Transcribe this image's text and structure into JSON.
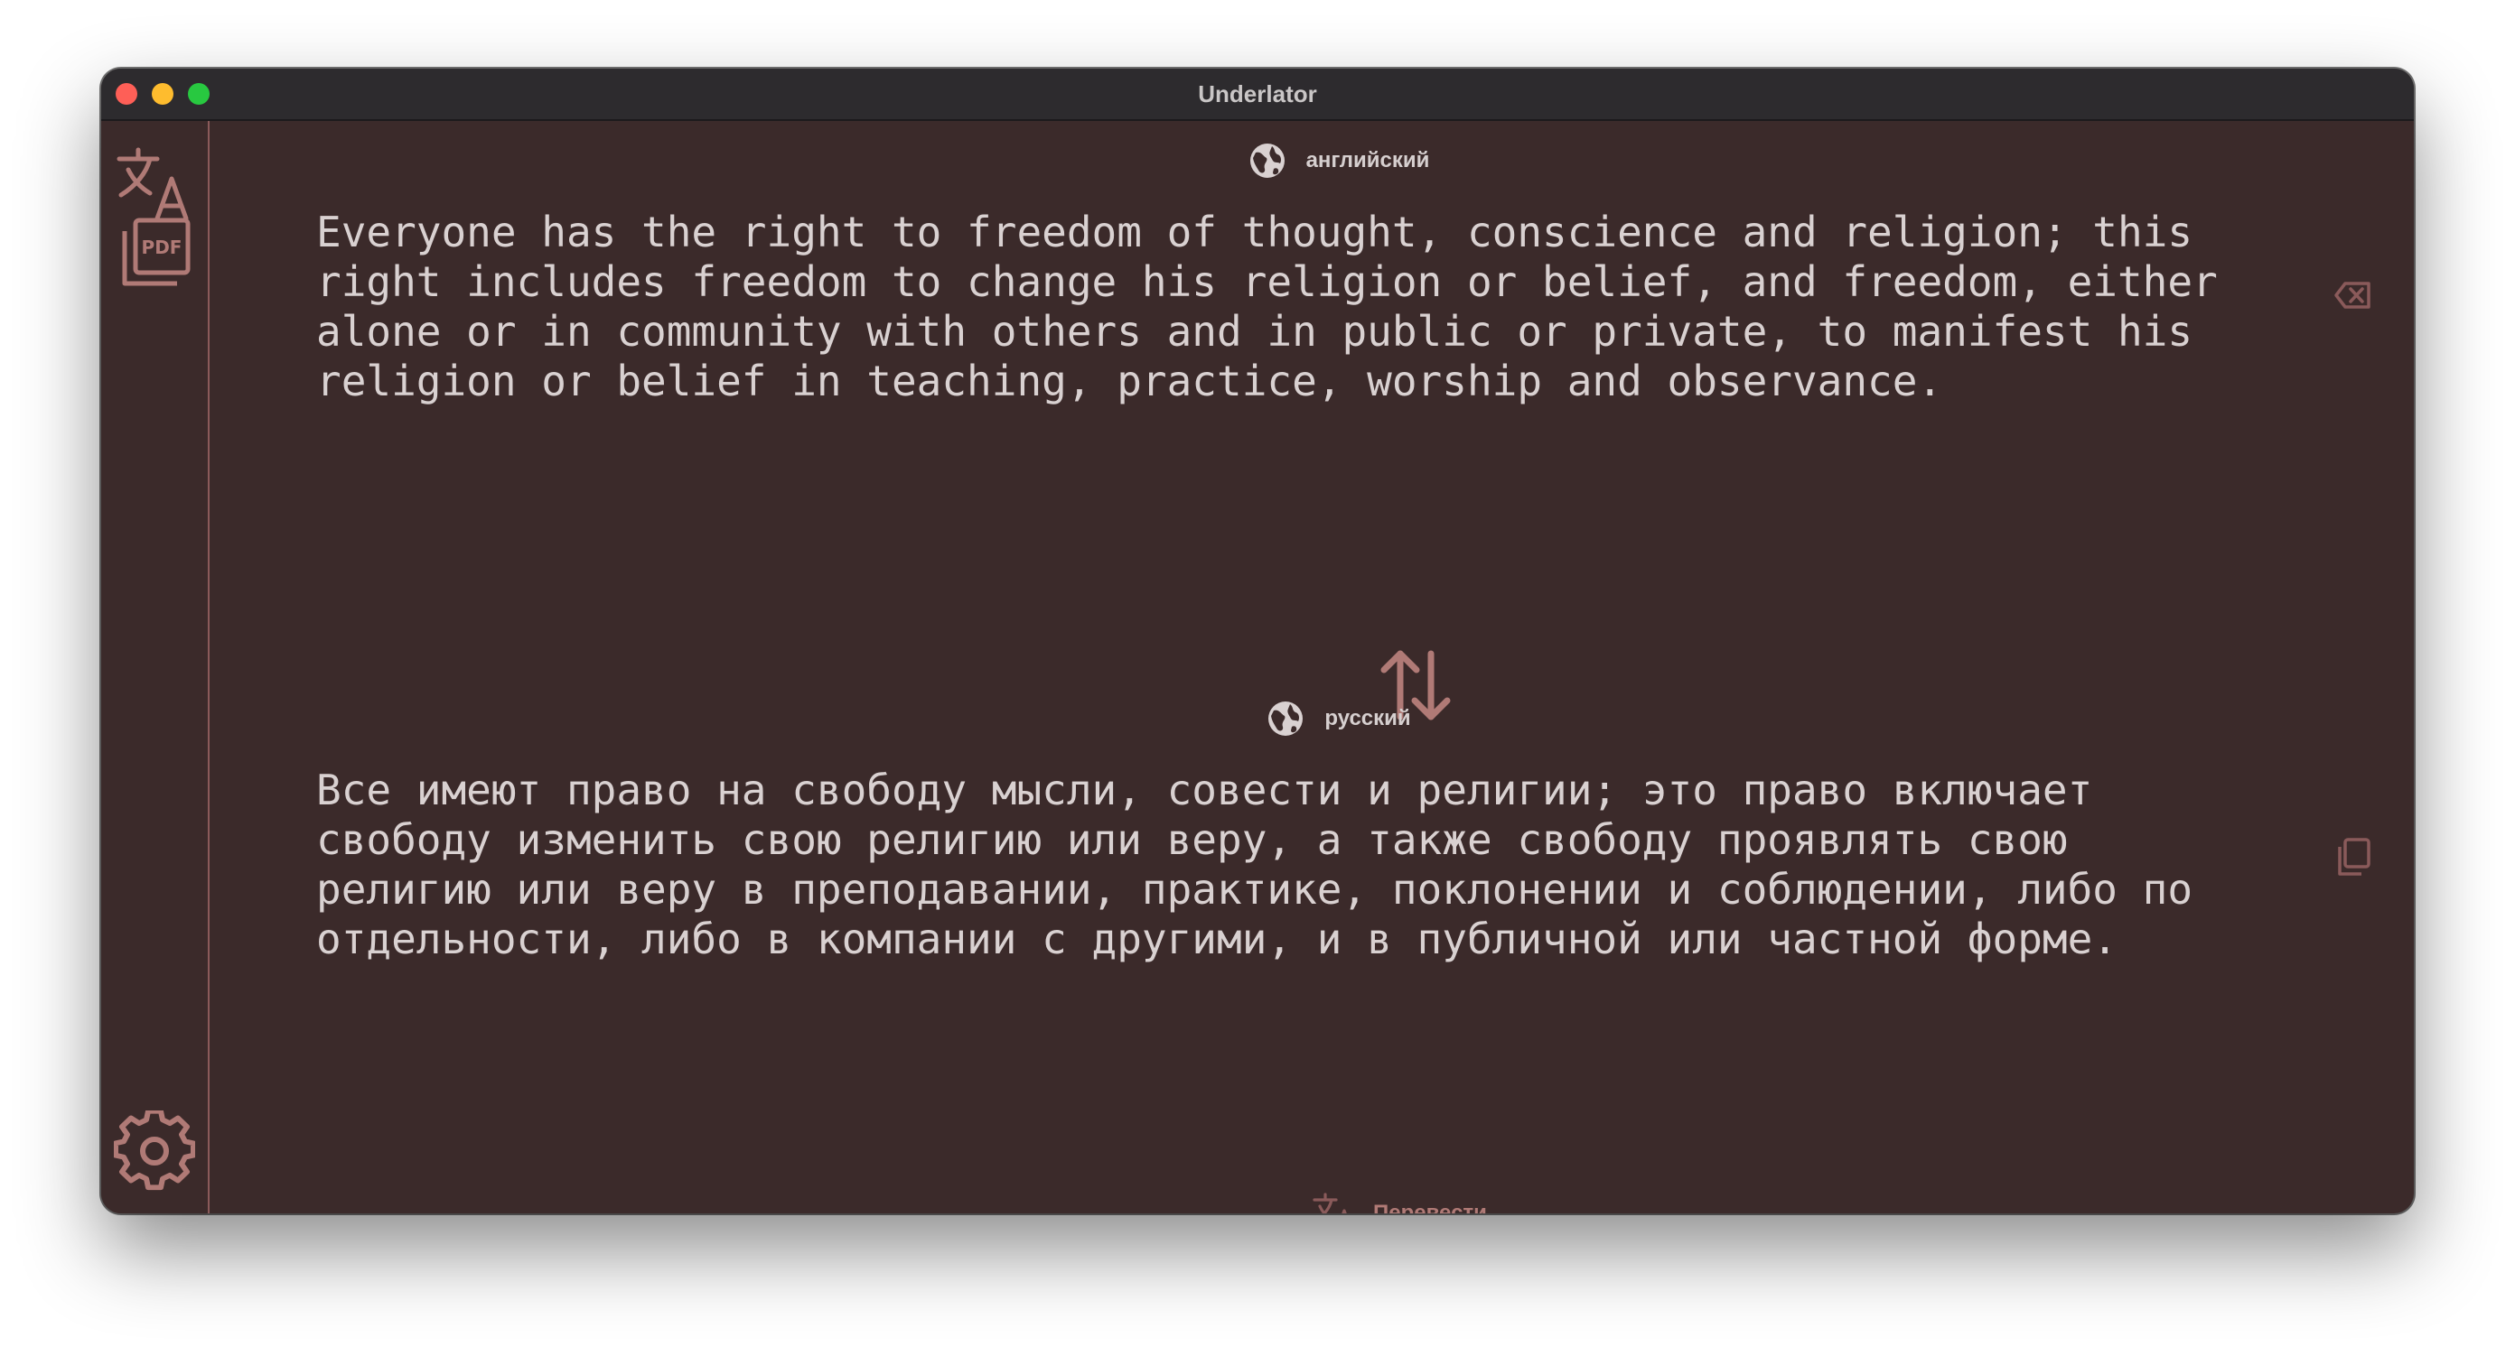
{
  "window": {
    "title": "Underlator"
  },
  "sidebar": {
    "items": [
      {
        "icon": "translate-icon",
        "label": "Translate"
      },
      {
        "icon": "pdf-icon",
        "label": "PDF"
      },
      {
        "icon": "gear-icon",
        "label": "Settings"
      }
    ]
  },
  "source": {
    "language": "английский",
    "text": "Everyone has the right to freedom of thought, conscience and religion; this\nright includes freedom to change his religion or belief, and freedom, either\nalone or in community with others and in public or private, to manifest his\nreligion or belief in teaching, practice, worship and observance."
  },
  "target": {
    "language": "русский",
    "text": "Все имеют право на свободу мысли, совести и религии; это право включает\nсвободу изменить свою религию или веру, а также свободу проявлять свою\nрелигию или веру в преподавании, практике, поклонении и соблюдении, либо по\nотдельности, либо в компании с другими, и в публичной или частной форме."
  },
  "actions": {
    "translate_label": "Перевести"
  },
  "colors": {
    "background": "#3b2a2a",
    "accent": "#b07a76",
    "text": "#d9d1d1",
    "titlebar": "#2d2b2e"
  }
}
